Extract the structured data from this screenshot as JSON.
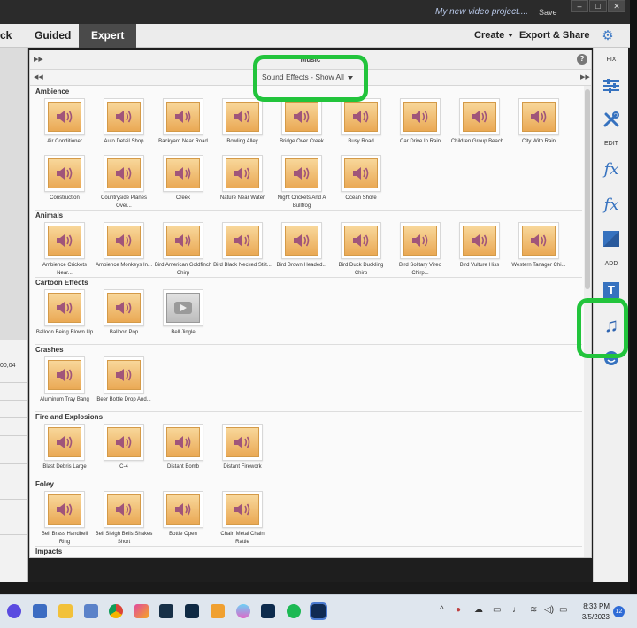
{
  "titlebar": {
    "project": "My new video project....",
    "save": "Save"
  },
  "menubar": {
    "quick_partial": "ck",
    "guided": "Guided",
    "expert": "Expert",
    "create": "Create",
    "export_share": "Export & Share"
  },
  "panel": {
    "title": "Music",
    "filter": "Sound Effects - Show All"
  },
  "timecode": "00;04",
  "categories": [
    {
      "name": "Ambience",
      "items": [
        {
          "label": "Air Conditioner",
          "icon": "speaker-icon"
        },
        {
          "label": "Auto Detail Shop",
          "icon": "speaker-icon"
        },
        {
          "label": "Backyard Near Road",
          "icon": "speaker-icon"
        },
        {
          "label": "Bowling Alley",
          "icon": "speaker-icon"
        },
        {
          "label": "Bridge Over Creek",
          "icon": "speaker-icon"
        },
        {
          "label": "Busy Road",
          "icon": "speaker-icon"
        },
        {
          "label": "Car Drive In Rain",
          "icon": "speaker-icon"
        },
        {
          "label": "Children Group Beach...",
          "icon": "speaker-icon"
        },
        {
          "label": "City With Rain",
          "icon": "speaker-icon"
        },
        {
          "label": "Construction",
          "icon": "speaker-icon"
        },
        {
          "label": "Countryside Planes Over...",
          "icon": "speaker-icon"
        },
        {
          "label": "Creek",
          "icon": "speaker-icon"
        },
        {
          "label": "Nature Near Water",
          "icon": "speaker-icon"
        },
        {
          "label": "Night Crickets And A Bullfrog",
          "icon": "speaker-icon"
        },
        {
          "label": "Ocean Shore",
          "icon": "speaker-icon"
        }
      ]
    },
    {
      "name": "Animals",
      "items": [
        {
          "label": "Ambience Crickets Near...",
          "icon": "speaker-icon"
        },
        {
          "label": "Ambience Monkeys In...",
          "icon": "speaker-icon"
        },
        {
          "label": "Bird American Goldfinch Chirp",
          "icon": "speaker-icon"
        },
        {
          "label": "Bird Black Necked Stilt...",
          "icon": "speaker-icon"
        },
        {
          "label": "Bird Brown Headed...",
          "icon": "speaker-icon"
        },
        {
          "label": "Bird Duck Duckling Chirp",
          "icon": "speaker-icon"
        },
        {
          "label": "Bird Solitary Vireo Chirp...",
          "icon": "speaker-icon"
        },
        {
          "label": "Bird Vulture Hiss",
          "icon": "speaker-icon"
        },
        {
          "label": "Western Tanager Chi...",
          "icon": "speaker-icon"
        }
      ]
    },
    {
      "name": "Cartoon Effects",
      "items": [
        {
          "label": "Balloon Being Blown Up",
          "icon": "speaker-icon"
        },
        {
          "label": "Balloon Pop",
          "icon": "speaker-icon"
        },
        {
          "label": "Bell Jingle",
          "icon": "play-icon"
        }
      ]
    },
    {
      "name": "Crashes",
      "items": [
        {
          "label": "Aluminum Tray Bang",
          "icon": "speaker-icon"
        },
        {
          "label": "Beer Bottle Drop And...",
          "icon": "speaker-icon"
        }
      ]
    },
    {
      "name": "Fire and Explosions",
      "items": [
        {
          "label": "Blast Debris Large",
          "icon": "speaker-icon"
        },
        {
          "label": "C-4",
          "icon": "speaker-icon"
        },
        {
          "label": "Distant Bomb",
          "icon": "speaker-icon"
        },
        {
          "label": "Distant Firework",
          "icon": "speaker-icon"
        }
      ]
    },
    {
      "name": "Foley",
      "items": [
        {
          "label": "Bell Brass Handbell Ring",
          "icon": "speaker-icon"
        },
        {
          "label": "Bell Sleigh Bells Shakes Short",
          "icon": "speaker-icon"
        },
        {
          "label": "Bottle Open",
          "icon": "speaker-icon"
        },
        {
          "label": "Chain Metal Chain Rattle",
          "icon": "speaker-icon"
        }
      ]
    },
    {
      "name": "Impacts",
      "items": []
    }
  ],
  "dock": {
    "fix": "FIX",
    "edit": "EDIT",
    "add": "ADD"
  },
  "taskbar": {
    "time": "8:33 PM",
    "date": "3/5/2023",
    "notifications": "12"
  },
  "colors": {
    "highlight": "#22c43c",
    "tile_fill": "#f0b765",
    "speaker": "#a0557a",
    "accent": "#3672bf"
  }
}
